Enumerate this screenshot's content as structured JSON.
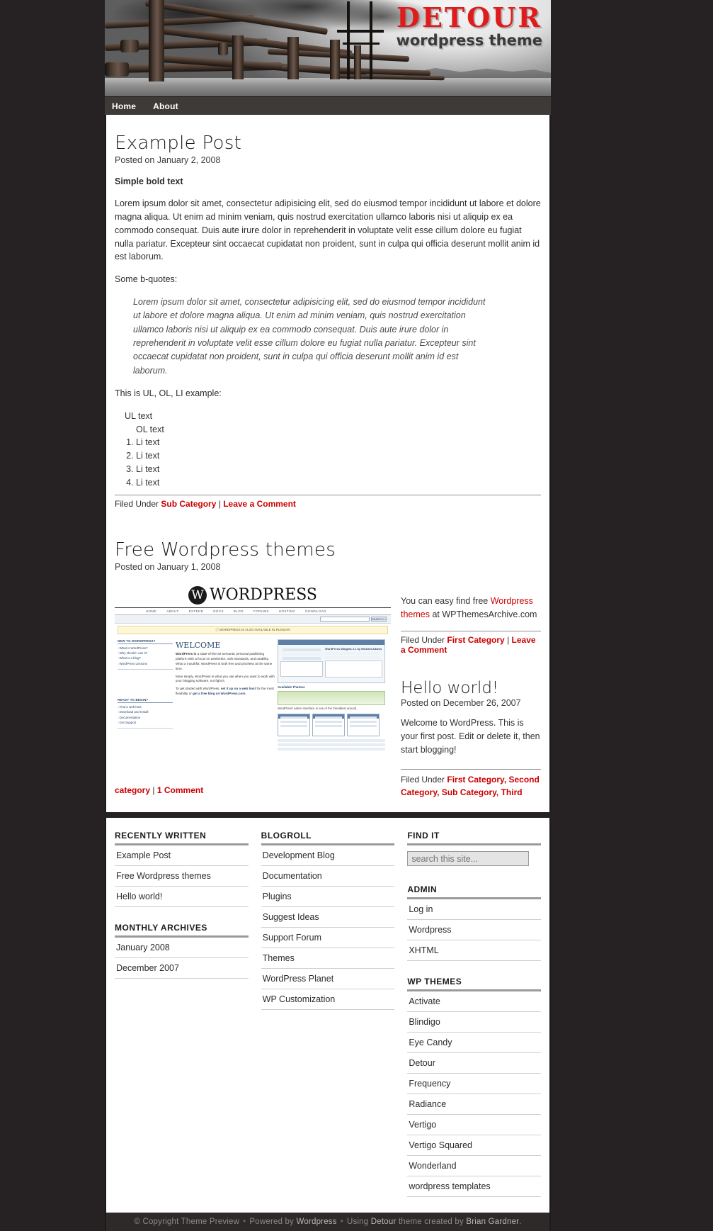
{
  "site": {
    "logo_title": "DETOUR",
    "logo_subtitle": "wordpress theme"
  },
  "nav": {
    "items": [
      {
        "label": "Home"
      },
      {
        "label": "About"
      }
    ]
  },
  "posts": [
    {
      "title": "Example Post",
      "date": "Posted on January 2, 2008",
      "bold_line": "Simple bold text",
      "body_1": "Lorem ipsum dolor sit amet, consectetur adipisicing elit, sed do eiusmod tempor incididunt ut labore et dolore magna aliqua. Ut enim ad minim veniam, quis nostrud exercitation ullamco laboris nisi ut aliquip ex ea commodo consequat. Duis aute irure dolor in reprehenderit in voluptate velit esse cillum dolore eu fugiat nulla pariatur. Excepteur sint occaecat cupidatat non proident, sunt in culpa qui officia deserunt mollit anim id est laborum.",
      "body_2": "Some b-quotes:",
      "blockquote": "Lorem ipsum dolor sit amet, consectetur adipisicing elit, sed do eiusmod tempor incididunt ut labore et dolore magna aliqua. Ut enim ad minim veniam, quis nostrud exercitation ullamco laboris nisi ut aliquip ex ea commodo consequat. Duis aute irure dolor in reprehenderit in voluptate velit esse cillum dolore eu fugiat nulla pariatur. Excepteur sint occaecat cupidatat non proident, sunt in culpa qui officia deserunt mollit anim id est laborum.",
      "body_3": "This is UL, OL, LI example:",
      "ul_item": "UL text",
      "ol_item": "OL text",
      "li_items": [
        "Li text",
        "Li text",
        "Li text",
        "Li text"
      ],
      "meta_prefix": "Filed Under",
      "meta_category": "Sub Category",
      "meta_separator": "|",
      "meta_comments": "Leave a Comment"
    },
    {
      "title": "Free Wordpress themes",
      "date": "Posted on January 1, 2008",
      "side_text_before": "You can easy find free ",
      "side_link": "Wordpress themes",
      "side_text_after": " at WPThemesArchive.com",
      "meta_prefix": "Filed Under",
      "meta_category": "First Category",
      "meta_separator": "|",
      "meta_comments": "Leave a Comment",
      "footer_category": "category",
      "footer_separator": "|",
      "footer_comments": "1 Comment"
    },
    {
      "title": "Hello world!",
      "date": "Posted on December 26, 2007",
      "body": "Welcome to WordPress. This is your first post. Edit or delete it, then start blogging!",
      "meta_prefix": "Filed Under",
      "meta_categories": "First Category, Second Category, Sub Category, Third"
    }
  ],
  "wp_screenshot": {
    "wordmark": "WORDPRESS",
    "menu": [
      "HOME",
      "ABOUT",
      "EXTEND",
      "DOCS",
      "BLOG",
      "FORUMS",
      "HOSTING",
      "DOWNLOAD"
    ],
    "search_button": "SEARCH »",
    "notice": "ⓘ WORDPRESS IS ALSO AVAILABLE IN RUSSIAN",
    "welcome_heading": "WELCOME",
    "welcome_lead": "WordPress is",
    "welcome_body": "a state-of-the-art semantic personal publishing platform with a focus on aesthetics, web standards, and usability. What a mouthful. WordPress is both free and priceless at the same time.",
    "welcome_body2": "More simply, WordPress is what you use when you want to work with your blogging software, not fight it.",
    "welcome_body3_a": "To get started with WordPress, ",
    "welcome_body3_b": "set it up on a web host",
    "welcome_body3_c": " for the most flexibility or ",
    "welcome_body3_d": "get a free blog on WordPress.com",
    "welcome_body3_e": ".",
    "nav_heading_1": "NEW TO WORDPRESS?",
    "nav_items_1": [
      "What is WordPress?",
      "Why should I use it?",
      "What is a blog?",
      "WordPress Lessons"
    ],
    "nav_heading_2": "READY TO BEGIN?",
    "nav_items_2": [
      "Find a web host",
      "Download and Install",
      "Documentation",
      "Get Support"
    ],
    "panel_heading": "Current Theme",
    "panel_subheading": "WordPress Widgets 2.1 by Michael Adams",
    "available_heading": "Available Themes",
    "admin_caption": "WordPress' admin interface is one of the friendliest around."
  },
  "widgets": {
    "columns": [
      {
        "sections": [
          {
            "title": "RECENTLY WRITTEN",
            "items": [
              "Example Post",
              "Free Wordpress themes",
              "Hello world!"
            ]
          },
          {
            "title": "MONTHLY ARCHIVES",
            "items": [
              "January 2008",
              "December 2007"
            ]
          }
        ]
      },
      {
        "sections": [
          {
            "title": "BLOGROLL",
            "items": [
              "Development Blog",
              "Documentation",
              "Plugins",
              "Suggest Ideas",
              "Support Forum",
              "Themes",
              "WordPress Planet",
              "WP Customization"
            ]
          }
        ]
      },
      {
        "sections": [
          {
            "title": "FIND IT",
            "search": {
              "value": "",
              "placeholder": "search this site..."
            }
          },
          {
            "title": "ADMIN",
            "items": [
              "Log in",
              "Wordpress",
              "XHTML"
            ]
          },
          {
            "title": "WP THEMES",
            "items": [
              "Activate",
              "Blindigo",
              "Eye Candy",
              "Detour",
              "Frequency",
              "Radiance",
              "Vertigo",
              "Vertigo Squared",
              "Wonderland",
              "wordpress templates"
            ]
          }
        ]
      }
    ]
  },
  "footer": {
    "copyright": "© Copyright Theme Preview",
    "powered_prefix": "Powered by",
    "powered_link": "Wordpress",
    "using_prefix": "Using",
    "using_link": "Detour",
    "using_mid": "theme created by",
    "author_link": "Brian Gardner",
    "period": "."
  },
  "colors": {
    "accent_red": "#cc0000",
    "frame_dark": "#262224",
    "nav_bar": "#3d3a38",
    "footer_bar": "#2d2a29"
  }
}
